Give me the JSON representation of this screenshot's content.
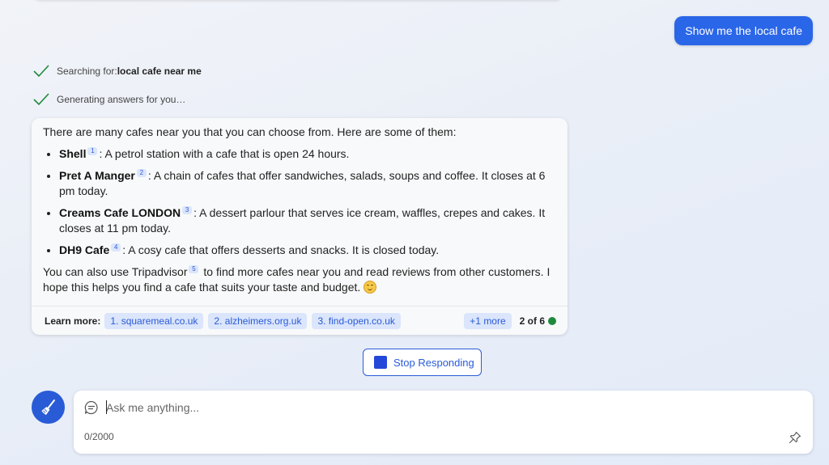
{
  "user_message": "Show me the local cafe",
  "status": [
    {
      "prefix": "Searching for: ",
      "bold": "local cafe near me"
    },
    {
      "prefix": "Generating answers for you…",
      "bold": ""
    }
  ],
  "answer": {
    "intro": "There are many cafes near you that you can choose from. Here are some of them:",
    "items": [
      {
        "name": "Shell",
        "ref": "1",
        "text": ": A petrol station with a cafe that is open 24 hours."
      },
      {
        "name": "Pret A Manger",
        "ref": "2",
        "text": ": A chain of cafes that offer sandwiches, salads, soups and coffee. It closes at 6 pm today."
      },
      {
        "name": "Creams Cafe LONDON",
        "ref": "3",
        "text": ": A dessert parlour that serves ice cream, waffles, crepes and cakes. It closes at 11 pm today."
      },
      {
        "name": "DH9 Cafe",
        "ref": "4",
        "text": ": A cosy cafe that offers desserts and snacks. It is closed today."
      }
    ],
    "outro_before": "You can also use Tripadvisor",
    "outro_ref": "5",
    "outro_after": " to find more cafes near you and read reviews from other customers. I hope this helps you find a cafe that suits your taste and budget. "
  },
  "learn_more": {
    "label": "Learn more:",
    "links": [
      "1. squaremeal.co.uk",
      "2. alzheimers.org.uk",
      "3. find-open.co.uk"
    ],
    "more": "+1 more",
    "page": "2 of 6"
  },
  "stop_button": "Stop Responding",
  "input": {
    "placeholder": "Ask me anything...",
    "counter": "0/2000"
  },
  "colors": {
    "accent": "#2a66e8",
    "chip_bg": "#dbe5fb",
    "chip_text": "#2a5bd7",
    "check": "#1e8a3c"
  }
}
